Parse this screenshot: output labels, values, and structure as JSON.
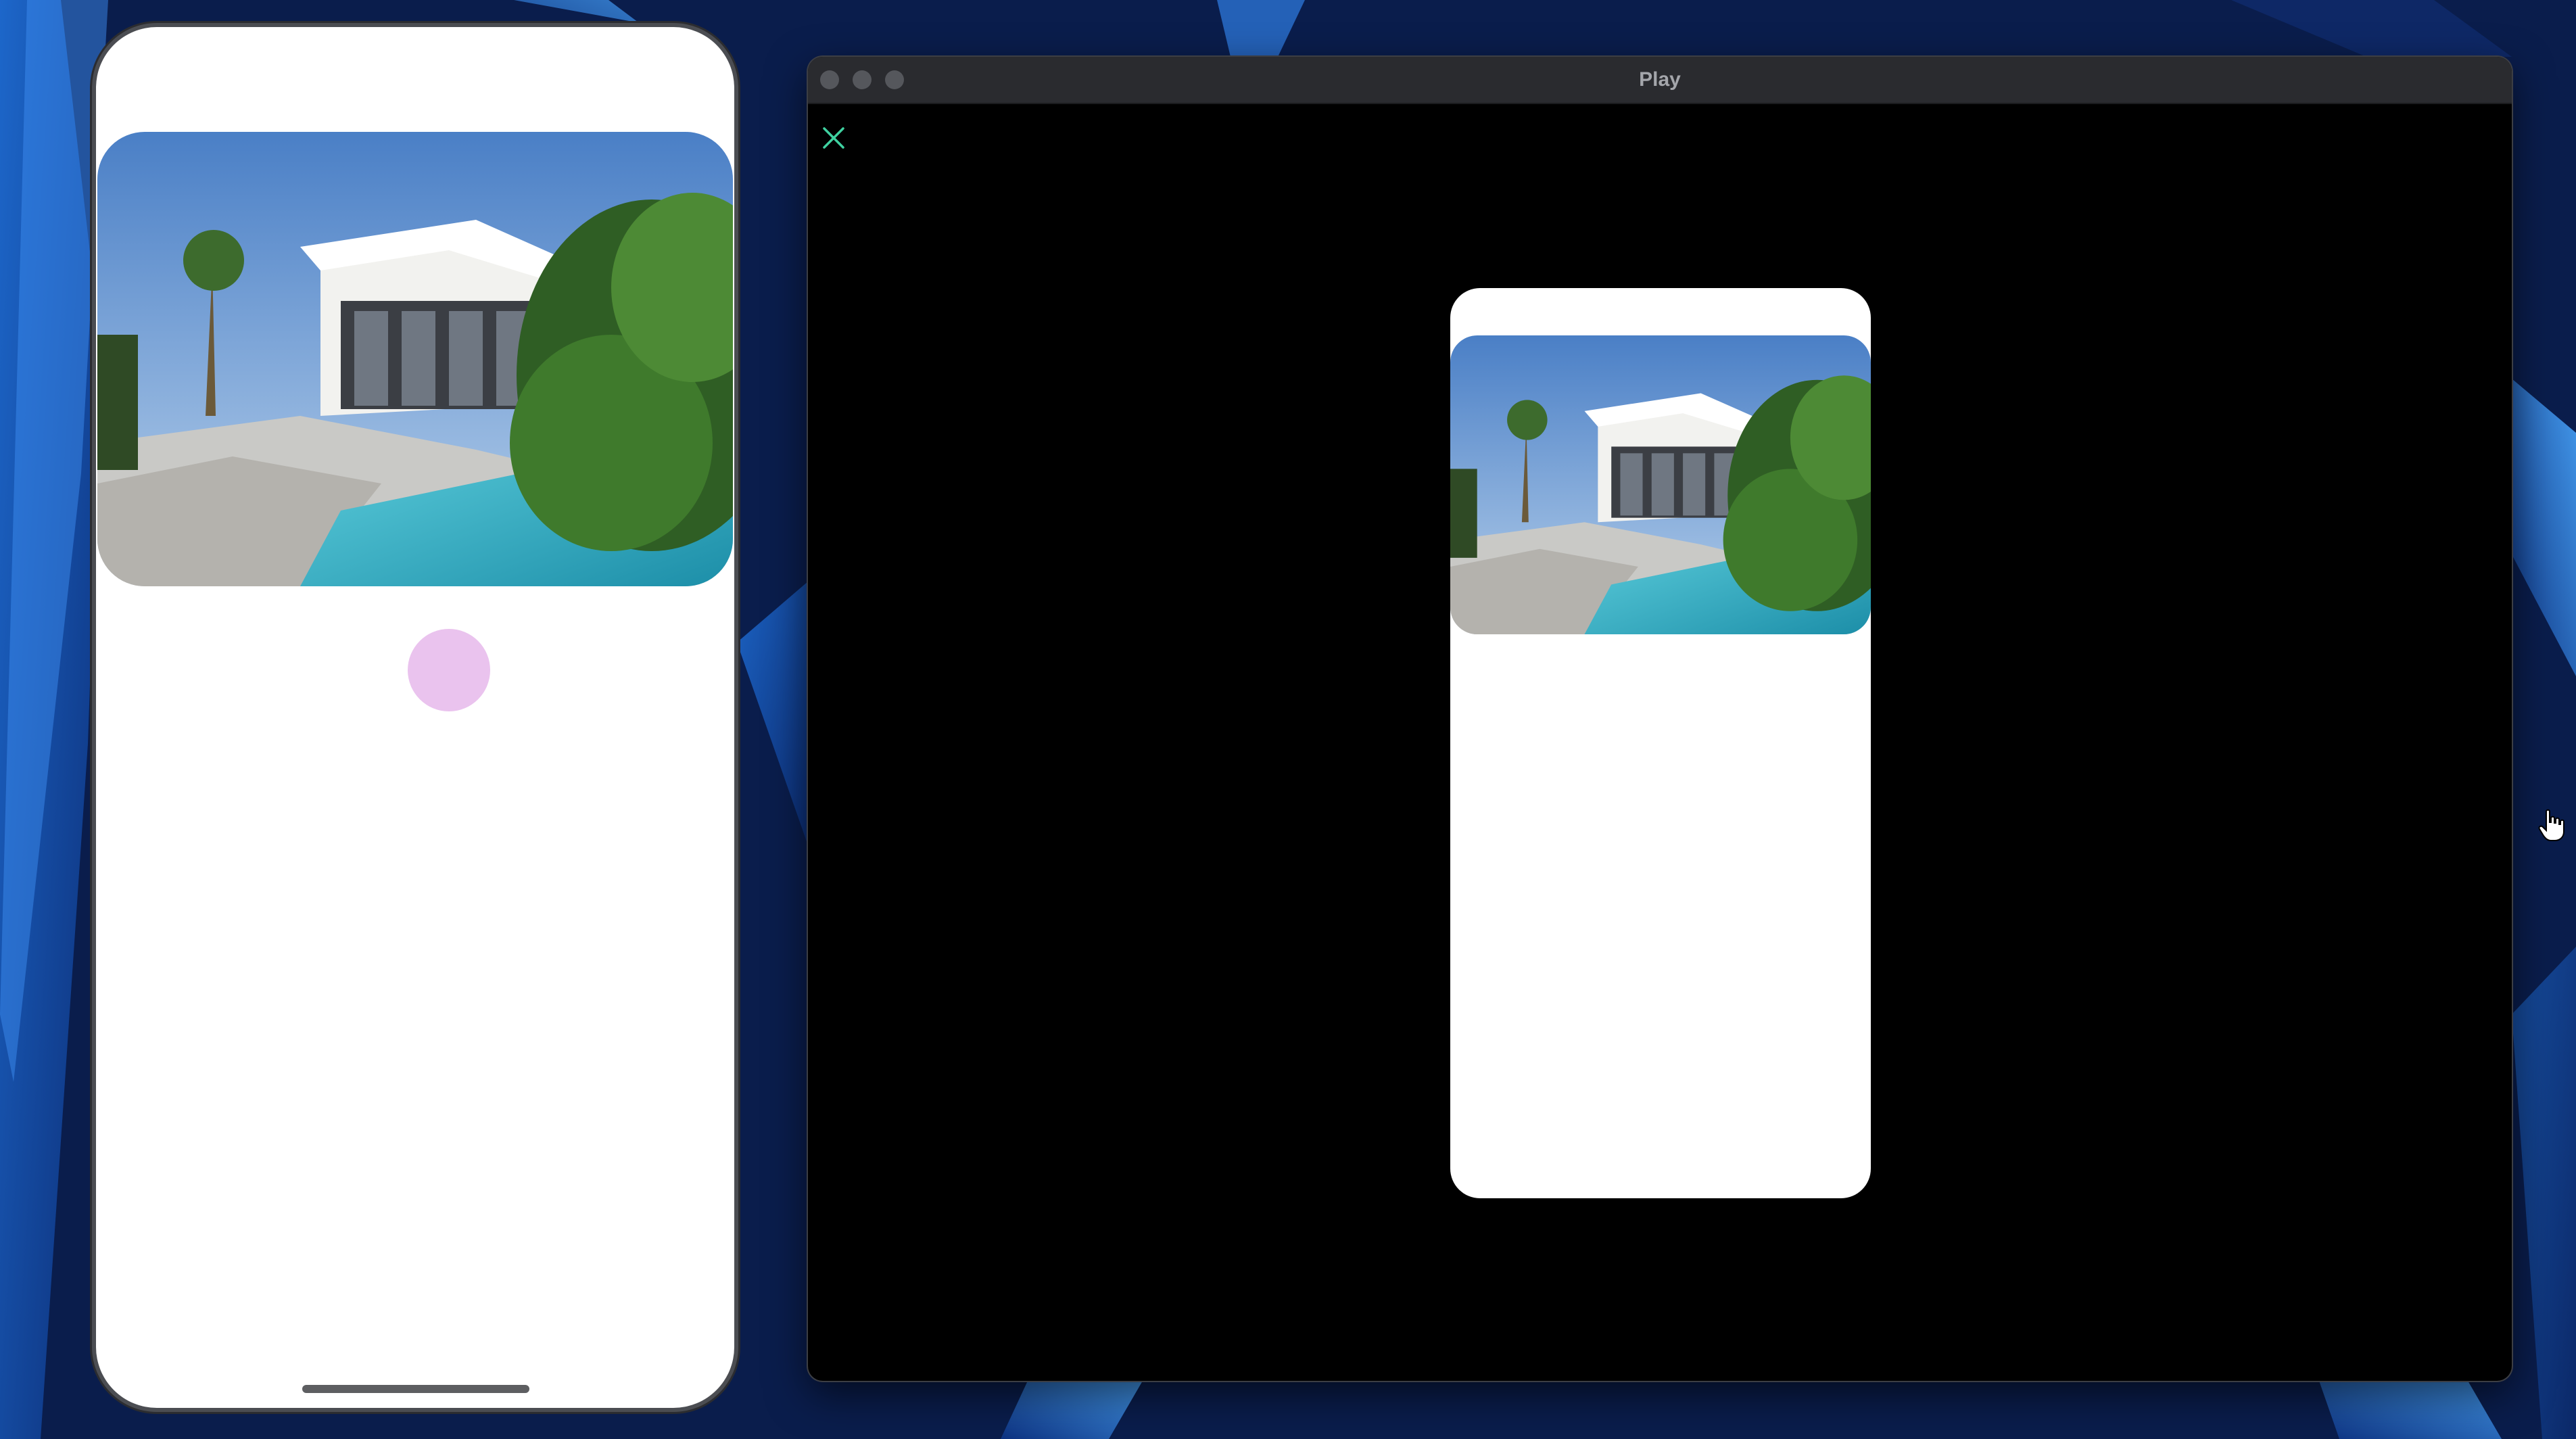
{
  "window": {
    "title": "Play",
    "close_icon": "close-icon"
  },
  "phone_simulator": {
    "photo": "house-with-pool-photo",
    "touch_indicator": "touch-indicator",
    "home_indicator": "home-indicator"
  },
  "preview": {
    "photo": "house-with-pool-photo"
  },
  "colors": {
    "touch_indicator": "#eac3ee",
    "window_background": "#000000",
    "titlebar": "#2a2b2f",
    "close_icon": "#3fd1a0"
  },
  "cursor": "pointing-hand-cursor"
}
